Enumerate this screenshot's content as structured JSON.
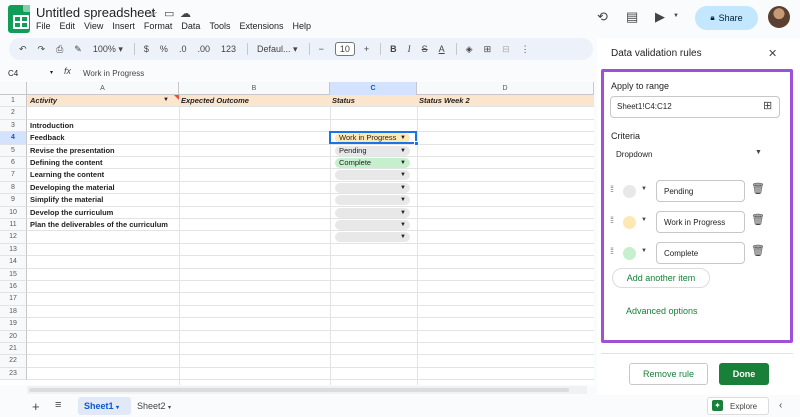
{
  "app": {
    "title": "Untitled spreadsheet",
    "menu": [
      "File",
      "Edit",
      "View",
      "Insert",
      "Format",
      "Data",
      "Tools",
      "Extensions",
      "Help"
    ],
    "share_label": "Share"
  },
  "toolbar": {
    "zoom": "100%",
    "currency": "$",
    "percent": "%",
    "dec_decrease": ".0",
    "dec_increase": ".00",
    "number_format": "123",
    "font": "Defaul...",
    "font_size": "10"
  },
  "formula_bar": {
    "cell_ref": "C4",
    "fx": "fx",
    "value": "Work in Progress"
  },
  "columns": [
    "A",
    "B",
    "C",
    "D"
  ],
  "rows": [
    "1",
    "2",
    "3",
    "4",
    "5",
    "6",
    "7",
    "8",
    "9",
    "10",
    "11",
    "12",
    "13",
    "14",
    "15",
    "16",
    "17",
    "18",
    "19",
    "20",
    "21",
    "22",
    "23"
  ],
  "header_row": {
    "a": "Activity",
    "b": "Expected Outcome",
    "c": "Status",
    "d": "Status Week 2"
  },
  "col_a": [
    "",
    "",
    "Introduction",
    "Feedback",
    "Revise the presentation",
    "Defining the content",
    "Learning the content",
    "Developing the material",
    "Simplify the material",
    "Develop the curriculum",
    "Plan the deliverables of the curriculum"
  ],
  "status_chips": [
    {
      "row": 4,
      "label": "Work in Progress",
      "color": "#fce8b2"
    },
    {
      "row": 5,
      "label": "Pending",
      "color": "#e8e8e8"
    },
    {
      "row": 6,
      "label": "Complete",
      "color": "#c6efce"
    },
    {
      "row": 7,
      "label": "",
      "color": "#e8e8e8"
    },
    {
      "row": 8,
      "label": "",
      "color": "#e8e8e8"
    },
    {
      "row": 9,
      "label": "",
      "color": "#e8e8e8"
    },
    {
      "row": 10,
      "label": "",
      "color": "#e8e8e8"
    },
    {
      "row": 11,
      "label": "",
      "color": "#e8e8e8"
    },
    {
      "row": 12,
      "label": "",
      "color": "#e8e8e8"
    }
  ],
  "sheets": {
    "active": "Sheet1",
    "other": "Sheet2"
  },
  "explore_label": "Explore",
  "panel": {
    "title": "Data validation rules",
    "apply_label": "Apply to range",
    "range_value": "Sheet1!C4:C12",
    "criteria_label": "Criteria",
    "criteria_value": "Dropdown",
    "items": [
      {
        "value": "Pending",
        "color": "#e8e8e8"
      },
      {
        "value": "Work in Progress",
        "color": "#fce8b2"
      },
      {
        "value": "Complete",
        "color": "#c6efce"
      }
    ],
    "add_item": "Add another item",
    "advanced": "Advanced options",
    "remove": "Remove rule",
    "done": "Done"
  },
  "colors": {
    "accent": "#188038",
    "outline": "#9e50d8",
    "share_bg": "#c2e7ff"
  }
}
